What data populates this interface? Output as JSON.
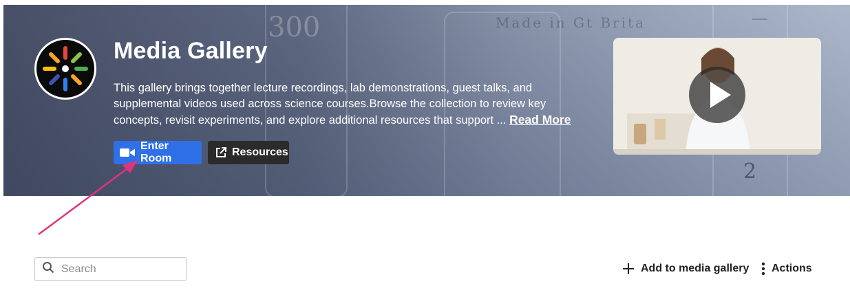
{
  "hero": {
    "title": "Media Gallery",
    "description": "This gallery brings together lecture recordings, lab demonstrations, guest talks, and supplemental videos used across science courses.Browse the collection to review key concepts, revisit experiments, and explore additional resources that support ... ",
    "read_more_label": "Read More",
    "enter_room_label": "Enter Room",
    "resources_label": "Resources",
    "background_text": [
      "300",
      "Made in Gt Brita",
      "2"
    ]
  },
  "toolbar": {
    "search_placeholder": "Search",
    "search_value": "",
    "add_label": "Add to media gallery",
    "actions_label": "Actions"
  },
  "colors": {
    "enter_room_bg": "#2f6fe8",
    "resources_bg": "#2b2b2b",
    "annotation_arrow": "#e0337d"
  }
}
